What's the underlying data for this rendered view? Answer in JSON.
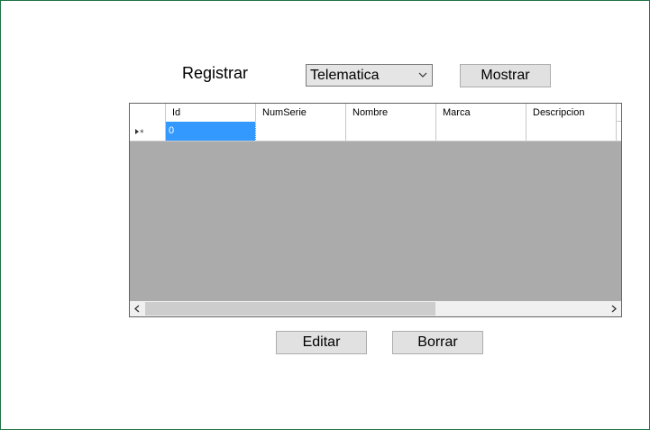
{
  "form": {
    "registrar_label": "Registrar",
    "combo": {
      "selected": "Telematica"
    },
    "mostrar_label": "Mostrar",
    "editar_label": "Editar",
    "borrar_label": "Borrar"
  },
  "grid": {
    "columns": [
      "Id",
      "NumSerie",
      "Nombre",
      "Marca",
      "Descripcion"
    ],
    "new_row": {
      "id": "0"
    }
  },
  "icons": {
    "row_marker": "new-row-asterisk-icon",
    "combo_arrow": "chevron-down-icon",
    "scroll_left": "chevron-left-icon",
    "scroll_right": "chevron-right-icon"
  },
  "colors": {
    "frame_border": "#1e7145",
    "selection": "#3399ff",
    "grid_background": "#ababab"
  }
}
